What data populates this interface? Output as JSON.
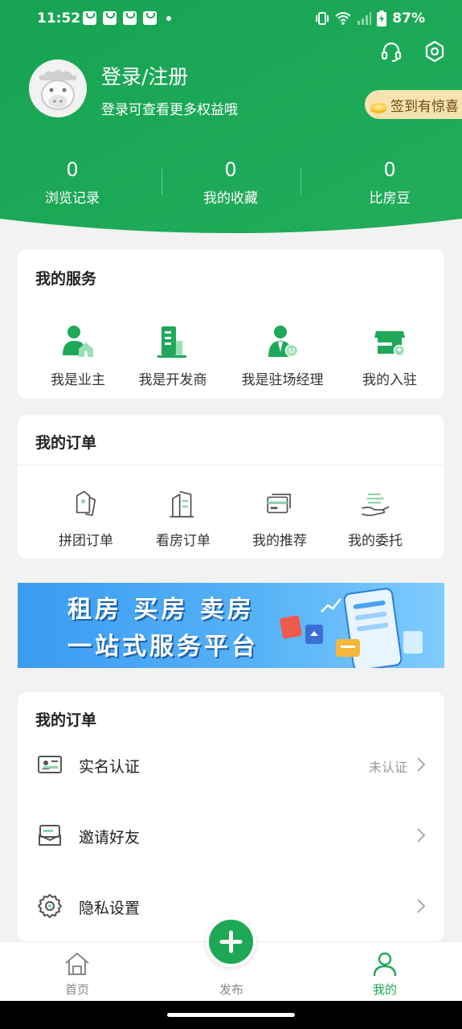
{
  "status_bar": {
    "time": "11:52",
    "battery": "87%"
  },
  "header": {
    "login_title": "登录/注册",
    "login_subtitle": "登录可查看更多权益哦",
    "signin_badge": "签到有惊喜",
    "stats": [
      {
        "value": "0",
        "label": "浏览记录"
      },
      {
        "value": "0",
        "label": "我的收藏"
      },
      {
        "value": "0",
        "label": "比房豆"
      }
    ]
  },
  "services": {
    "title": "我的服务",
    "items": [
      {
        "label": "我是业主",
        "icon": "owner-icon"
      },
      {
        "label": "我是开发商",
        "icon": "developer-icon"
      },
      {
        "label": "我是驻场经理",
        "icon": "manager-icon"
      },
      {
        "label": "我的入驻",
        "icon": "store-icon"
      }
    ]
  },
  "orders": {
    "title": "我的订单",
    "items": [
      {
        "label": "拼团订单",
        "icon": "group-tag-icon"
      },
      {
        "label": "看房订单",
        "icon": "building-icon"
      },
      {
        "label": "我的推荐",
        "icon": "recommend-card-icon"
      },
      {
        "label": "我的委托",
        "icon": "entrust-hand-icon"
      }
    ]
  },
  "banner": {
    "line1": "租房 买房 卖房",
    "line2": "一站式服务平台"
  },
  "settings": {
    "title": "我的订单",
    "rows": [
      {
        "label": "实名认证",
        "status": "未认证",
        "icon": "id-card-icon"
      },
      {
        "label": "邀请好友",
        "status": "",
        "icon": "invite-icon"
      },
      {
        "label": "隐私设置",
        "status": "",
        "icon": "gear-icon"
      }
    ]
  },
  "bottom_nav": {
    "items": [
      {
        "label": "首页",
        "icon": "home-icon"
      },
      {
        "label": "发布",
        "icon": "plus-icon"
      },
      {
        "label": "我的",
        "icon": "user-icon"
      }
    ],
    "active": "我的"
  },
  "colors": {
    "brand_green": "#1da756",
    "background": "#f2f2f2",
    "signin_bg": "#f6e3b0"
  }
}
